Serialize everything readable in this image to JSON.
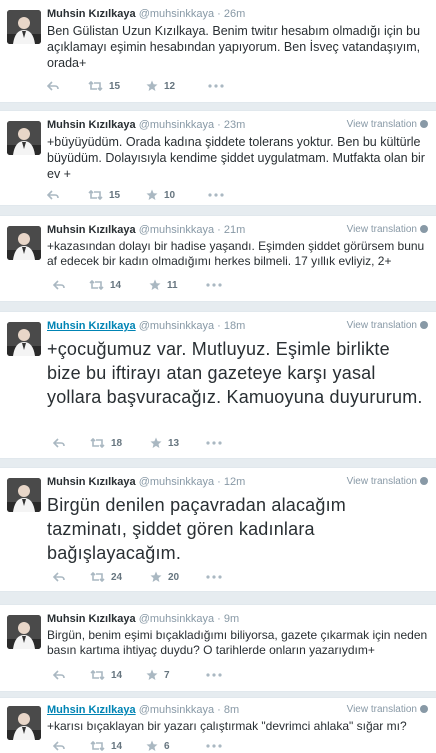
{
  "user": {
    "fullname": "Muhsin Kızılkaya",
    "username": "@muhsinkkaya"
  },
  "view_translation_label": "View translation",
  "tweets": [
    {
      "time": "26m",
      "text": "Ben Gülistan Uzun Kızılkaya. Benim twitır hesabım olmadığı için bu açıklamayı eşimin hesabından yapıyorum. Ben İsveç vatandaşıyım, orada+",
      "retweets": "15",
      "favorites": "12"
    },
    {
      "time": "23m",
      "text": "+büyüyüdüm. Orada kadına şiddete tolerans yoktur. Ben bu kültürle büyüdüm. Dolayısıyla kendime şiddet uygulatmam. Mutfakta olan bir ev +",
      "retweets": "15",
      "favorites": "10"
    },
    {
      "time": "21m",
      "text": "+kazasından dolayı bir hadise yaşandı. Eşimden şiddet görürsem bunu af edecek bir kadın olmadığımı herkes bilmeli. 17 yıllık evliyiz, 2+",
      "retweets": "14",
      "favorites": "11"
    },
    {
      "time": "18m",
      "text": "+çocuğumuz var. Mutluyuz. Eşimle birlikte bize bu iftirayı atan gazeteye karşı yasal yollara başvuracağız. Kamuoyuna duyururum.",
      "retweets": "18",
      "favorites": "13"
    },
    {
      "time": "12m",
      "text": "Birgün denilen paçavradan alacağım tazminatı, şiddet gören kadınlara bağışlayacağım.",
      "retweets": "24",
      "favorites": "20"
    },
    {
      "time": "9m",
      "text": "Birgün, benim eşimi bıçakladığımı biliyorsa, gazete çıkarmak için neden basın kartıma ihtiyaç duydu? O tarihlerde onların yazarıydım+",
      "retweets": "14",
      "favorites": "7"
    },
    {
      "time": "8m",
      "text": "+karısı bıçaklayan bir yazarı çalıştırmak \"devrimci ahlaka\" sığar mı?",
      "retweets": "14",
      "favorites": "6"
    }
  ]
}
